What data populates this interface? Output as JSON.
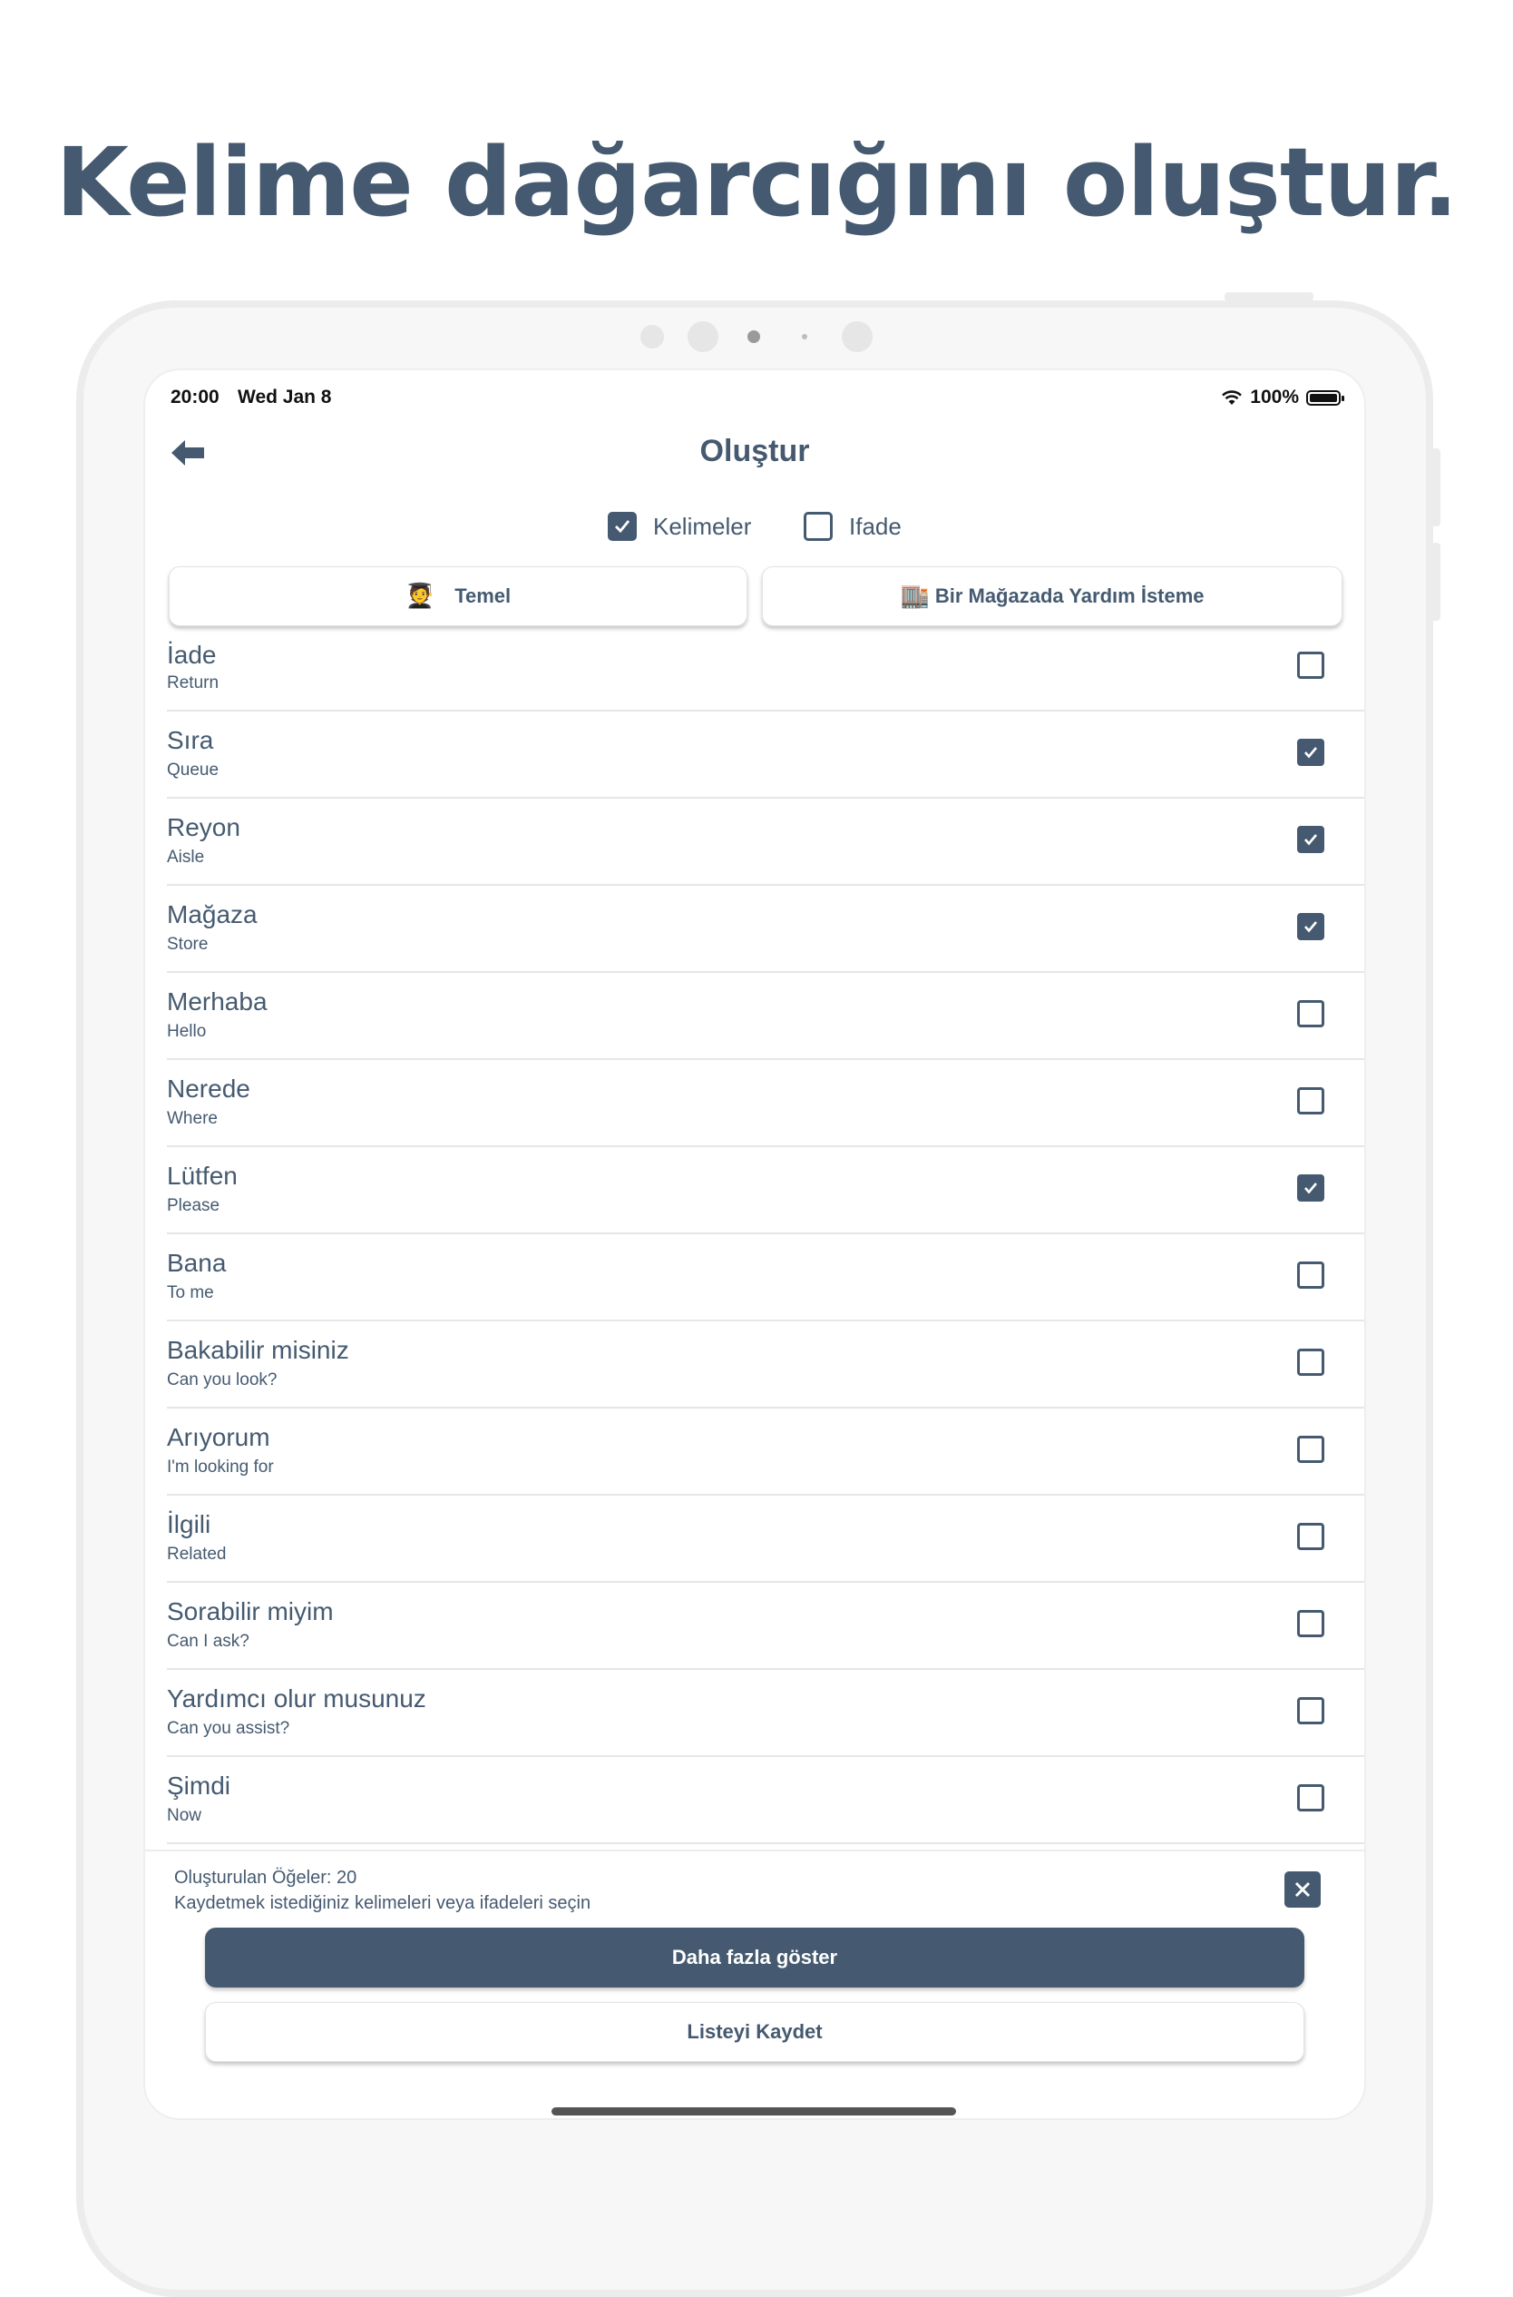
{
  "headline": "Kelime dağarcığını oluştur.",
  "status_bar": {
    "time": "20:00",
    "date": "Wed Jan 8",
    "battery": "100%"
  },
  "header": {
    "title": "Oluştur",
    "back_icon": "arrow-left-icon"
  },
  "mode_toggle": [
    {
      "label": "Kelimeler",
      "checked": true
    },
    {
      "label": "Ifade",
      "checked": false
    }
  ],
  "topics": [
    {
      "emoji": "🧑‍🎓",
      "label": "Temel"
    },
    {
      "emoji": "🏬",
      "label": "Bir Mağazada Yardım İsteme"
    }
  ],
  "items": [
    {
      "word": "İade",
      "translation": "Return",
      "checked": false
    },
    {
      "word": "Sıra",
      "translation": "Queue",
      "checked": true
    },
    {
      "word": "Reyon",
      "translation": "Aisle",
      "checked": true
    },
    {
      "word": "Mağaza",
      "translation": "Store",
      "checked": true
    },
    {
      "word": "Merhaba",
      "translation": "Hello",
      "checked": false
    },
    {
      "word": "Nerede",
      "translation": "Where",
      "checked": false
    },
    {
      "word": "Lütfen",
      "translation": "Please",
      "checked": true
    },
    {
      "word": "Bana",
      "translation": "To me",
      "checked": false
    },
    {
      "word": "Bakabilir misiniz",
      "translation": "Can you look?",
      "checked": false
    },
    {
      "word": "Arıyorum",
      "translation": "I'm looking for",
      "checked": false
    },
    {
      "word": "İlgili",
      "translation": "Related",
      "checked": false
    },
    {
      "word": "Sorabilir miyim",
      "translation": "Can I ask?",
      "checked": false
    },
    {
      "word": "Yardımcı olur musunuz",
      "translation": "Can you assist?",
      "checked": false
    },
    {
      "word": "Şimdi",
      "translation": "Now",
      "checked": false
    }
  ],
  "footer": {
    "count_text": "Oluşturulan Öğeler: 20",
    "hint_text": "Kaydetmek istediğiniz kelimeleri veya ifadeleri seçin",
    "show_more_label": "Daha fazla göster",
    "save_label": "Listeyi Kaydet"
  },
  "colors": {
    "accent": "#455a70",
    "background": "#ffffff",
    "frame": "#f7f7f7"
  }
}
